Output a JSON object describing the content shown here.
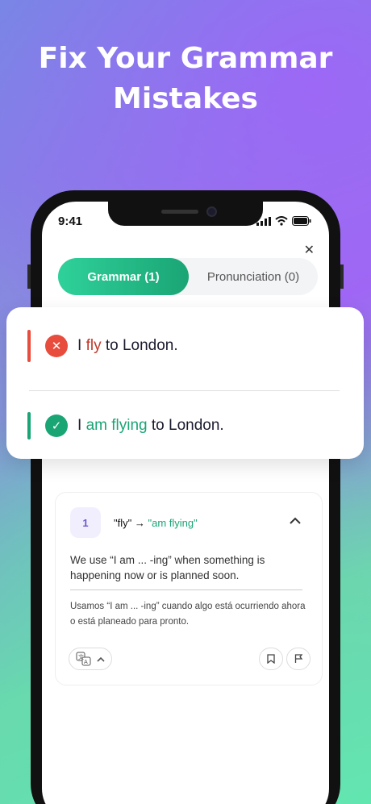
{
  "headline": {
    "line1": "Fix Your Grammar",
    "line2": "Mistakes"
  },
  "status_bar": {
    "time": "9:41"
  },
  "tabs": [
    {
      "label": "Grammar (1)",
      "active": true
    },
    {
      "label": "Pronunciation (0)",
      "active": false
    }
  ],
  "incorrect": {
    "before": "I ",
    "highlight": "fly",
    "after": " to London."
  },
  "correct": {
    "before": "I ",
    "highlight": "am flying",
    "after": " to London."
  },
  "explanation": {
    "number": "1",
    "from": "\"fly\"",
    "arrow": "→",
    "to": "\"am flying\"",
    "english": "We use “I am ... -ing” when something is happening now or is planned soon.",
    "spanish": "Usamos “I am ... -ing” cuando algo está ocurriendo ahora o está planeado para pronto."
  },
  "colors": {
    "accent": "#1aa575",
    "error": "#e74c3c",
    "tab_gradient_start": "#2fd19a"
  },
  "icons": [
    "close-icon",
    "x-icon",
    "check-icon",
    "chevron-up-icon",
    "translate-icon",
    "bookmark-icon",
    "flag-icon"
  ]
}
